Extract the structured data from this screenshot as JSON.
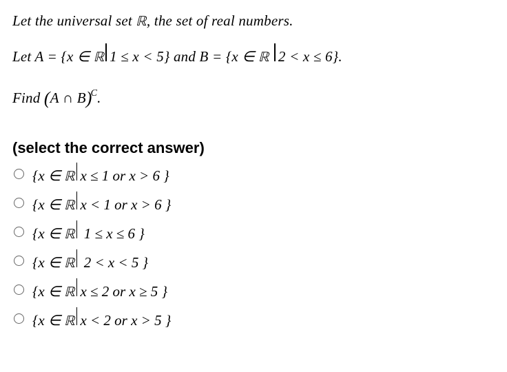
{
  "question": {
    "line1_prefix": "Let the universal set ",
    "line1_R": "ℝ",
    "line1_suffix": ", the set of real numbers.",
    "line2_letA": "Let  A",
    "line2_eq1": " = {",
    "line2_x1": "x",
    "line2_in1": " ∈ ",
    "line2_R1": "ℝ",
    "line2_cond1": "1 ≤ x < 5",
    "line2_close1": "}  and  B",
    "line2_eq2": " = {",
    "line2_x2": "x",
    "line2_in2": " ∈ ",
    "line2_R2": "ℝ",
    "line2_cond2": "2 < x ≤ 6",
    "line2_close2": "}.",
    "line3_find": "Find  ",
    "line3_open": "(",
    "line3_A": "A",
    "line3_inter": " ∩ ",
    "line3_B": "B",
    "line3_close": ")",
    "line3_sup": "C",
    "line3_period": "."
  },
  "instruction": "(select the correct answer)",
  "options": [
    {
      "x": "x",
      "in": " ∈ ",
      "R": "ℝ",
      "cond": "x ≤ 1 or x > 6 "
    },
    {
      "x": "x",
      "in": " ∈ ",
      "R": "ℝ",
      "cond": "x < 1 or x > 6 "
    },
    {
      "x": "x",
      "in": " ∈ ",
      "R": "ℝ",
      "cond": " 1 ≤  x ≤ 6 "
    },
    {
      "x": "x",
      "in": " ∈ ",
      "R": "ℝ",
      "cond": " 2 < x < 5 "
    },
    {
      "x": "x",
      "in": " ∈ ",
      "R": "ℝ",
      "cond": "x ≤ 2 or x ≥ 5 "
    },
    {
      "x": "x",
      "in": " ∈ ",
      "R": "ℝ",
      "cond": "x < 2 or x > 5 "
    }
  ],
  "braces": {
    "open": "{",
    "close": "}"
  }
}
